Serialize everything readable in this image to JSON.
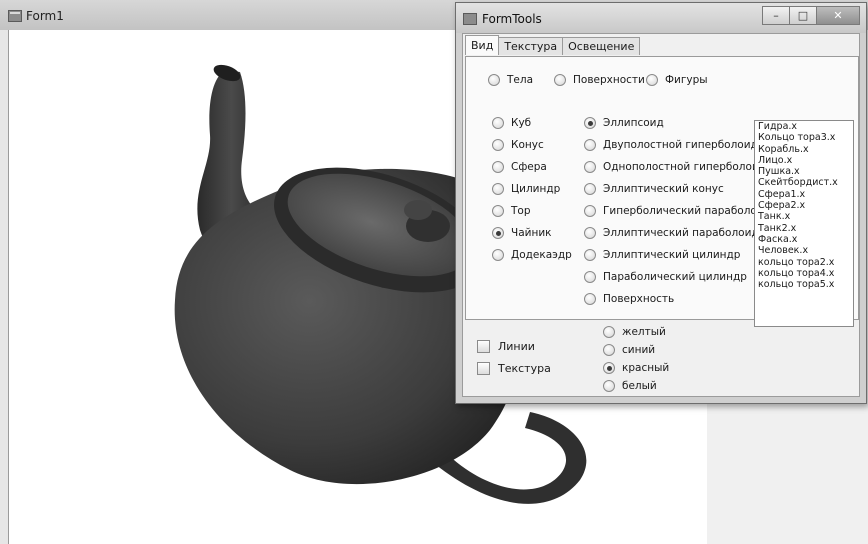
{
  "form1": {
    "title": "Form1",
    "icon": "window-app-icon"
  },
  "formtools": {
    "title": "FormTools",
    "icon": "window-app-icon",
    "window_buttons": {
      "minimize": "–",
      "maximize": "□",
      "close": "✕"
    },
    "tabs": [
      {
        "label": "Вид",
        "active": true
      },
      {
        "label": "Текстура",
        "active": false
      },
      {
        "label": "Освещение",
        "active": false
      }
    ],
    "categories": [
      {
        "label": "Тела",
        "selected": false
      },
      {
        "label": "Поверхности",
        "selected": false
      },
      {
        "label": "Фигуры",
        "selected": false
      }
    ],
    "bodies": [
      {
        "label": "Куб",
        "selected": false
      },
      {
        "label": "Конус",
        "selected": false
      },
      {
        "label": "Сфера",
        "selected": false
      },
      {
        "label": "Цилиндр",
        "selected": false
      },
      {
        "label": "Тор",
        "selected": false
      },
      {
        "label": "Чайник",
        "selected": true
      },
      {
        "label": "Додекаэдр",
        "selected": false
      }
    ],
    "surfaces": [
      {
        "label": "Эллипсоид",
        "selected": true
      },
      {
        "label": "Двуполостной гиперболоид",
        "selected": false
      },
      {
        "label": "Однополостной гиперболоид",
        "selected": false
      },
      {
        "label": "Эллиптический конус",
        "selected": false
      },
      {
        "label": "Гиперболический параболоид",
        "selected": false
      },
      {
        "label": "Эллиптический параболоид",
        "selected": false
      },
      {
        "label": "Эллиптический цилиндр",
        "selected": false
      },
      {
        "label": "Параболический цилиндр",
        "selected": false
      },
      {
        "label": "Поверхность",
        "selected": false
      }
    ],
    "files": [
      "Гидра.x",
      "Кольцо тора3.x",
      "Корабль.x",
      "Лицо.x",
      "Пушка.x",
      "Скейтбордист.x",
      "Сфера1.x",
      "Сфера2.x",
      "Танк.x",
      "Танк2.x",
      "Фаска.x",
      "Человек.x",
      "кольцо тора2.x",
      "кольцо тора4.x",
      "кольцо тора5.x"
    ],
    "checkboxes": [
      {
        "label": "Линии",
        "checked": false
      },
      {
        "label": "Текстура",
        "checked": false
      }
    ],
    "colors": [
      {
        "label": "желтый",
        "selected": false
      },
      {
        "label": "синий",
        "selected": false
      },
      {
        "label": "красный",
        "selected": true
      },
      {
        "label": "белый",
        "selected": false
      }
    ]
  }
}
